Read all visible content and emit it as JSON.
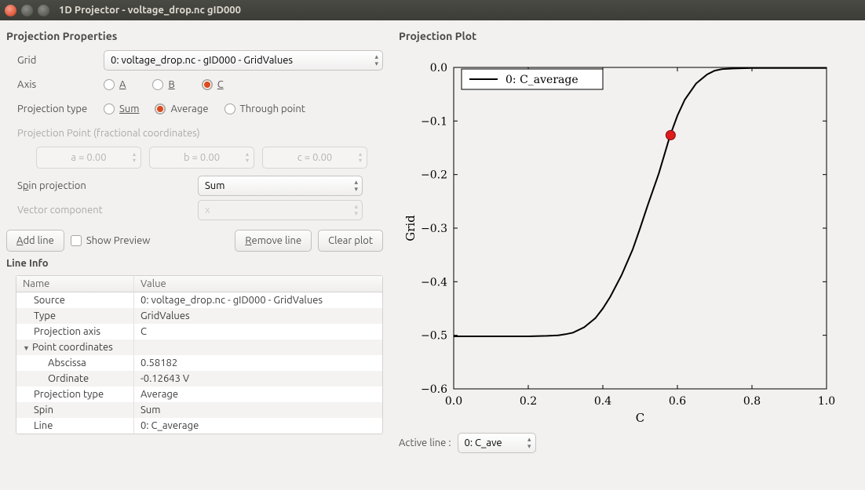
{
  "window": {
    "title": "1D Projector - voltage_drop.nc gID000"
  },
  "left": {
    "section": "Projection Properties",
    "grid": {
      "label": "Grid",
      "value": "0: voltage_drop.nc - gID000 - GridValues"
    },
    "axis": {
      "label": "Axis",
      "options": {
        "a": "A",
        "b": "B",
        "c": "C"
      },
      "selected": "c"
    },
    "ptype": {
      "label": "Projection type",
      "options": {
        "sum": "Sum",
        "avg": "Average",
        "tp": "Through point"
      },
      "selected": "avg"
    },
    "ppoint": {
      "label": "Projection Point (fractional coordinates)",
      "a": "a = 0.00",
      "b": "b = 0.00",
      "c": "c = 0.00"
    },
    "spin": {
      "label": "Spin projection",
      "value": "Sum"
    },
    "vcomp": {
      "label": "Vector component",
      "value": "x"
    },
    "buttons": {
      "add": "Add line",
      "showpreview": "Show Preview",
      "remove": "Remove line",
      "clear": "Clear plot"
    },
    "lineinfo": {
      "title": "Line Info",
      "headers": {
        "name": "Name",
        "value": "Value"
      },
      "rows": [
        {
          "name": "Source",
          "value": "0: voltage_drop.nc - gID000 - GridValues",
          "indent": 1
        },
        {
          "name": "Type",
          "value": "GridValues",
          "indent": 1,
          "alt": true
        },
        {
          "name": "Projection axis",
          "value": "C",
          "indent": 1
        },
        {
          "name": "Point coordinates",
          "value": "",
          "indent": 0,
          "toggle": true,
          "alt": true
        },
        {
          "name": "Abscissa",
          "value": "0.58182",
          "indent": 2
        },
        {
          "name": "Ordinate",
          "value": "-0.12643 V",
          "indent": 2,
          "alt": true
        },
        {
          "name": "Projection type",
          "value": "Average",
          "indent": 1
        },
        {
          "name": "Spin",
          "value": "Sum",
          "indent": 1,
          "alt": true
        },
        {
          "name": "Line",
          "value": "0: C_average",
          "indent": 1
        }
      ]
    }
  },
  "right": {
    "section": "Projection Plot",
    "activeline": {
      "label": "Active line :",
      "value": "0: C_ave"
    }
  },
  "chart_data": {
    "type": "line",
    "xlabel": "C",
    "ylabel": "Grid",
    "xlim": [
      0.0,
      1.0
    ],
    "ylim": [
      -0.6,
      0.0
    ],
    "xticks": [
      0.0,
      0.2,
      0.4,
      0.6,
      0.8,
      1.0
    ],
    "yticks": [
      0.0,
      -0.1,
      -0.2,
      -0.3,
      -0.4,
      -0.5,
      -0.6
    ],
    "legend": {
      "items": [
        "0: C_average"
      ],
      "position": "upper-left-inset"
    },
    "series": [
      {
        "name": "0: C_average",
        "x": [
          0.0,
          0.05,
          0.1,
          0.15,
          0.2,
          0.25,
          0.28,
          0.3,
          0.32,
          0.35,
          0.38,
          0.4,
          0.42,
          0.45,
          0.48,
          0.5,
          0.52,
          0.55,
          0.58,
          0.6,
          0.62,
          0.65,
          0.68,
          0.7,
          0.72,
          0.75,
          0.8,
          0.85,
          0.9,
          0.95,
          1.0
        ],
        "y": [
          -0.502,
          -0.502,
          -0.502,
          -0.502,
          -0.502,
          -0.501,
          -0.5,
          -0.498,
          -0.495,
          -0.485,
          -0.468,
          -0.45,
          -0.428,
          -0.388,
          -0.34,
          -0.3,
          -0.258,
          -0.198,
          -0.128,
          -0.09,
          -0.06,
          -0.03,
          -0.013,
          -0.006,
          -0.003,
          -0.002,
          -0.001,
          -0.001,
          -0.001,
          -0.001,
          -0.001
        ]
      }
    ],
    "marker": {
      "x": 0.58182,
      "y": -0.12643
    }
  }
}
